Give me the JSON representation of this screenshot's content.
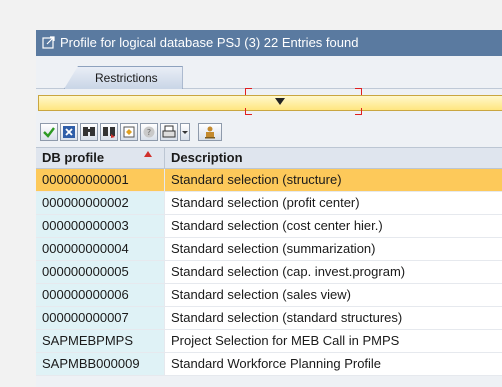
{
  "window": {
    "title": "Profile for logical database PSJ (3)   22 Entries found"
  },
  "tabs": [
    {
      "label": "Restrictions"
    }
  ],
  "toolbar": {
    "buttons": [
      {
        "icon": "checkmark-icon"
      },
      {
        "icon": "close-x-icon"
      },
      {
        "icon": "find-icon"
      },
      {
        "icon": "find-next-icon"
      },
      {
        "icon": "select-all-icon"
      },
      {
        "icon": "info-icon"
      },
      {
        "icon": "print-icon"
      },
      {
        "icon": "dropdown-icon"
      },
      {
        "icon": "personal-list-icon"
      }
    ]
  },
  "table": {
    "columns": [
      "DB profile",
      "Description"
    ],
    "rows": [
      {
        "profile": "000000000001",
        "description": "Standard selection (structure)"
      },
      {
        "profile": "000000000002",
        "description": "Standard selection (profit center)"
      },
      {
        "profile": "000000000003",
        "description": "Standard selection (cost center hier.)"
      },
      {
        "profile": "000000000004",
        "description": "Standard selection (summarization)"
      },
      {
        "profile": "000000000005",
        "description": "Standard selection (cap. invest.program)"
      },
      {
        "profile": "000000000006",
        "description": "Standard selection (sales view)"
      },
      {
        "profile": "000000000007",
        "description": "Standard selection (standard structures)"
      },
      {
        "profile": "SAPMEBPMPS",
        "description": "Project Selection for MEB Call in PMPS"
      },
      {
        "profile": "SAPMBB000009",
        "description": "Standard Workforce Planning Profile"
      }
    ],
    "selected_row": 0
  },
  "colors": {
    "title_bar": "#5a7aa0",
    "selected_row": "#fdc95a",
    "key_column": "#dff2f6",
    "selection_bar": "#ffe680"
  }
}
